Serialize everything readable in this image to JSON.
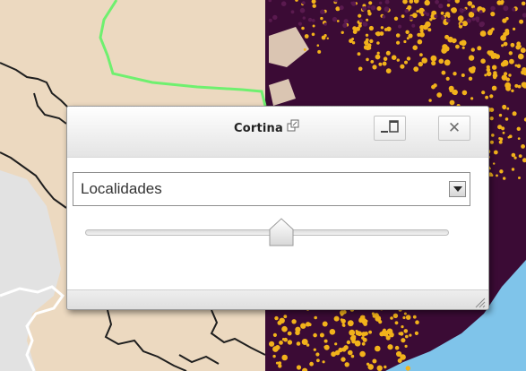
{
  "window": {
    "title": "Cortina",
    "icons": {
      "popout": "popout-icon",
      "maximize": "maximize-icon",
      "close": "close-icon",
      "dropdown": "chevron-down-icon",
      "resize": "resize-grip-icon"
    },
    "close_label": "✕"
  },
  "layer_select": {
    "selected": "Localidades"
  },
  "curtain_slider": {
    "value_fraction": 0.54
  },
  "colors": {
    "land": "#ecd9c0",
    "left_gray": "#e2e2e2",
    "dark_layer": "#3b0b35",
    "dot_yellow": "#f2b21b",
    "water": "#7fc4ea",
    "boundary": "#1f1f1f",
    "highlight_border": "#6ff06f",
    "white_border": "#ffffff"
  }
}
